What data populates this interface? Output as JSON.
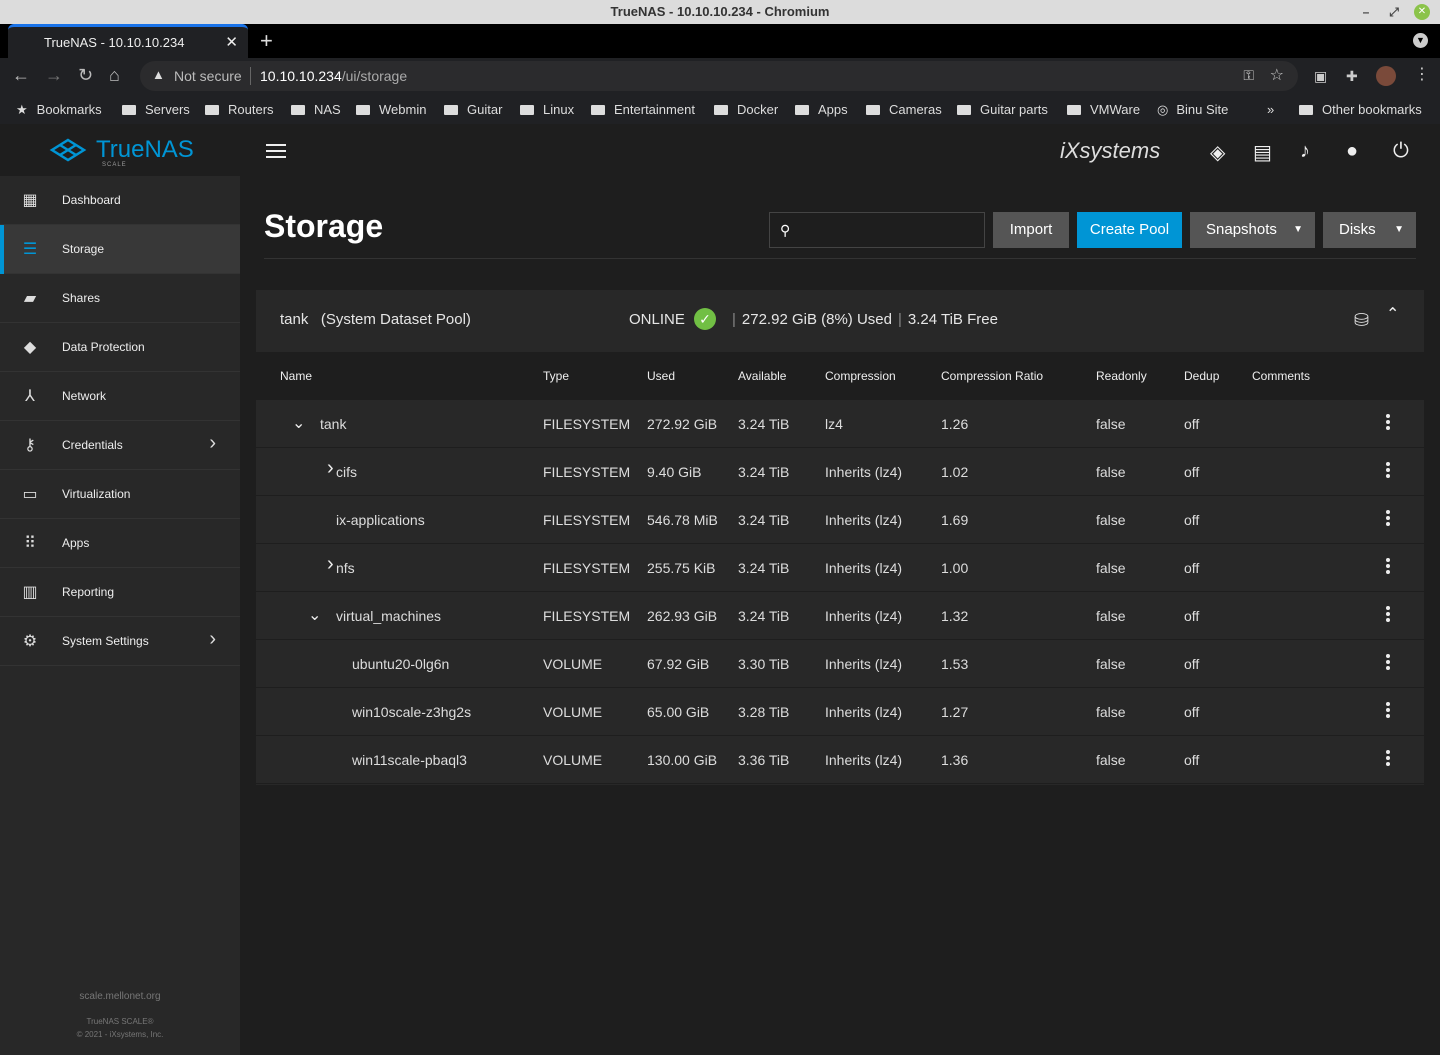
{
  "window": {
    "title": "TrueNAS - 10.10.10.234 - Chromium"
  },
  "tab": {
    "title": "TrueNAS - 10.10.10.234",
    "close": "✕",
    "new": "+"
  },
  "omnibox": {
    "security": "Not secure",
    "host": "10.10.10.234",
    "path": "/ui/storage"
  },
  "bookmarks": [
    {
      "label": "Bookmarks"
    },
    {
      "label": "Servers"
    },
    {
      "label": "Routers"
    },
    {
      "label": "NAS"
    },
    {
      "label": "Webmin"
    },
    {
      "label": "Guitar"
    },
    {
      "label": "Linux"
    },
    {
      "label": "Entertainment"
    },
    {
      "label": "Docker"
    },
    {
      "label": "Apps"
    },
    {
      "label": "Cameras"
    },
    {
      "label": "Guitar parts"
    },
    {
      "label": "VMWare"
    },
    {
      "label": "Binu Site"
    },
    {
      "label": "Other bookmarks"
    }
  ],
  "brand": {
    "name": "TrueNAS",
    "edition": "SCALE",
    "vendor": "iXsystems"
  },
  "sidebar": {
    "items": [
      {
        "label": "Dashboard",
        "icon": "dashboard-icon"
      },
      {
        "label": "Storage",
        "icon": "storage-icon",
        "active": true
      },
      {
        "label": "Shares",
        "icon": "shares-icon"
      },
      {
        "label": "Data Protection",
        "icon": "shield-icon"
      },
      {
        "label": "Network",
        "icon": "network-icon"
      },
      {
        "label": "Credentials",
        "icon": "key-icon",
        "submenu": true
      },
      {
        "label": "Virtualization",
        "icon": "laptop-icon"
      },
      {
        "label": "Apps",
        "icon": "apps-grid-icon"
      },
      {
        "label": "Reporting",
        "icon": "chart-icon"
      },
      {
        "label": "System Settings",
        "icon": "gear-icon",
        "submenu": true
      }
    ],
    "footer": {
      "hostname": "scale.mellonet.org",
      "product": "TrueNAS SCALE®",
      "copyright": "© 2021 - iXsystems, Inc."
    }
  },
  "page": {
    "title": "Storage",
    "search_placeholder": "",
    "buttons": {
      "import": "Import",
      "create_pool": "Create Pool",
      "snapshots": "Snapshots",
      "disks": "Disks"
    }
  },
  "pool": {
    "name": "tank",
    "role": "(System Dataset Pool)",
    "status": "ONLINE",
    "used": "272.92 GiB (8%) Used",
    "free": "3.24 TiB Free",
    "columns": [
      "Name",
      "Type",
      "Used",
      "Available",
      "Compression",
      "Compression Ratio",
      "Readonly",
      "Dedup",
      "Comments"
    ],
    "rows": [
      {
        "name": "tank",
        "depth": 0,
        "toggle": "expanded",
        "type": "FILESYSTEM",
        "used": "272.92 GiB",
        "available": "3.24 TiB",
        "compression": "lz4",
        "ratio": "1.26",
        "readonly": "false",
        "dedup": "off",
        "comments": ""
      },
      {
        "name": "cifs",
        "depth": 1,
        "toggle": "collapsed",
        "type": "FILESYSTEM",
        "used": "9.40 GiB",
        "available": "3.24 TiB",
        "compression": "Inherits (lz4)",
        "ratio": "1.02",
        "readonly": "false",
        "dedup": "off",
        "comments": ""
      },
      {
        "name": "ix-applications",
        "depth": 1,
        "toggle": "none",
        "type": "FILESYSTEM",
        "used": "546.78 MiB",
        "available": "3.24 TiB",
        "compression": "Inherits (lz4)",
        "ratio": "1.69",
        "readonly": "false",
        "dedup": "off",
        "comments": ""
      },
      {
        "name": "nfs",
        "depth": 1,
        "toggle": "collapsed",
        "type": "FILESYSTEM",
        "used": "255.75 KiB",
        "available": "3.24 TiB",
        "compression": "Inherits (lz4)",
        "ratio": "1.00",
        "readonly": "false",
        "dedup": "off",
        "comments": ""
      },
      {
        "name": "virtual_machines",
        "depth": 1,
        "toggle": "expanded",
        "type": "FILESYSTEM",
        "used": "262.93 GiB",
        "available": "3.24 TiB",
        "compression": "Inherits (lz4)",
        "ratio": "1.32",
        "readonly": "false",
        "dedup": "off",
        "comments": ""
      },
      {
        "name": "ubuntu20-0lg6n",
        "depth": 2,
        "toggle": "none",
        "type": "VOLUME",
        "used": "67.92 GiB",
        "available": "3.30 TiB",
        "compression": "Inherits (lz4)",
        "ratio": "1.53",
        "readonly": "false",
        "dedup": "off",
        "comments": ""
      },
      {
        "name": "win10scale-z3hg2s",
        "depth": 2,
        "toggle": "none",
        "type": "VOLUME",
        "used": "65.00 GiB",
        "available": "3.28 TiB",
        "compression": "Inherits (lz4)",
        "ratio": "1.27",
        "readonly": "false",
        "dedup": "off",
        "comments": ""
      },
      {
        "name": "win11scale-pbaql3",
        "depth": 2,
        "toggle": "none",
        "type": "VOLUME",
        "used": "130.00 GiB",
        "available": "3.36 TiB",
        "compression": "Inherits (lz4)",
        "ratio": "1.36",
        "readonly": "false",
        "dedup": "off",
        "comments": ""
      }
    ]
  },
  "colors": {
    "accent": "#0095d5",
    "online": "#71bf44",
    "panel": "#282828",
    "background": "#1e1e1e"
  }
}
